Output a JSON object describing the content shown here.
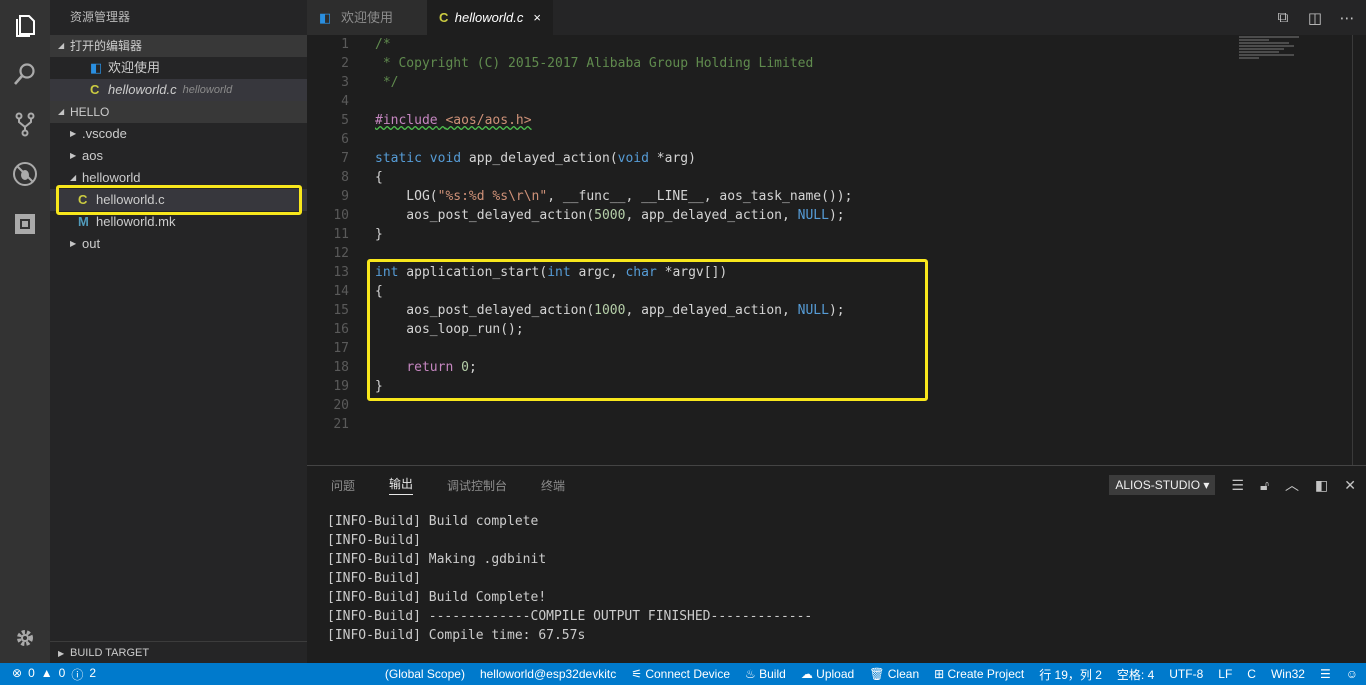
{
  "activity_bar": {
    "icons": [
      "explorer-icon",
      "search-icon",
      "source-control-icon",
      "debug-icon",
      "extensions-icon"
    ],
    "settings_icon": "gear-icon"
  },
  "sidebar": {
    "title": "资源管理器",
    "open_editors": {
      "label": "打开的编辑器",
      "items": [
        {
          "icon": "vscode-icon",
          "name": "欢迎使用",
          "desc": ""
        },
        {
          "icon": "c-file-icon",
          "name": "helloworld.c",
          "desc": "helloworld"
        }
      ]
    },
    "workspace": {
      "label": "HELLO",
      "items": [
        {
          "type": "folder",
          "name": ".vscode",
          "expanded": false
        },
        {
          "type": "folder",
          "name": "aos",
          "expanded": false
        },
        {
          "type": "folder",
          "name": "helloworld",
          "expanded": true
        },
        {
          "type": "file",
          "icon": "C",
          "name": "helloworld.c",
          "selected": true
        },
        {
          "type": "file",
          "icon": "M",
          "name": "helloworld.mk"
        },
        {
          "type": "folder",
          "name": "out",
          "expanded": false
        }
      ]
    },
    "bottom_section": "BUILD TARGET"
  },
  "tabs": [
    {
      "label": "欢迎使用",
      "icon": "vscode-icon",
      "active": false
    },
    {
      "label": "helloworld.c",
      "icon": "C",
      "active": true,
      "close": "×"
    }
  ],
  "tab_actions": [
    "open-preview-icon",
    "split-editor-icon",
    "more-icon"
  ],
  "editor": {
    "lines": [
      "/*",
      " * Copyright (C) 2015-2017 Alibaba Group Holding Limited",
      " */",
      "",
      "#include <aos/aos.h>",
      "",
      "static void app_delayed_action(void *arg)",
      "{",
      "    LOG(\"%s:%d %s\\r\\n\", __func__, __LINE__, aos_task_name());",
      "    aos_post_delayed_action(5000, app_delayed_action, NULL);",
      "}",
      "",
      "int application_start(int argc, char *argv[])",
      "{",
      "    aos_post_delayed_action(1000, app_delayed_action, NULL);",
      "    aos_loop_run();",
      "",
      "    return 0;",
      "}",
      "",
      ""
    ]
  },
  "panel": {
    "tabs": [
      "问题",
      "输出",
      "调试控制台",
      "终端"
    ],
    "active_tab": "输出",
    "channel": "ALIOS-STUDIO",
    "output": [
      "[INFO-Build] Build complete",
      "[INFO-Build]",
      "[INFO-Build] Making .gdbinit",
      "[INFO-Build]",
      "[INFO-Build] Build Complete!",
      "[INFO-Build] -------------COMPILE OUTPUT FINISHED-------------",
      "[INFO-Build] Compile time: 67.57s"
    ]
  },
  "status_bar": {
    "errors": "0",
    "warnings": "0",
    "infos": "2",
    "scope": "(Global Scope)",
    "target": "helloworld@esp32devkitc",
    "connect": "Connect Device",
    "build": "Build",
    "upload": "Upload",
    "clean": "Clean",
    "create": "Create Project",
    "position": "行 19，列 2",
    "spaces": "空格: 4",
    "encoding": "UTF-8",
    "eol": "LF",
    "language": "C",
    "platform": "Win32"
  }
}
